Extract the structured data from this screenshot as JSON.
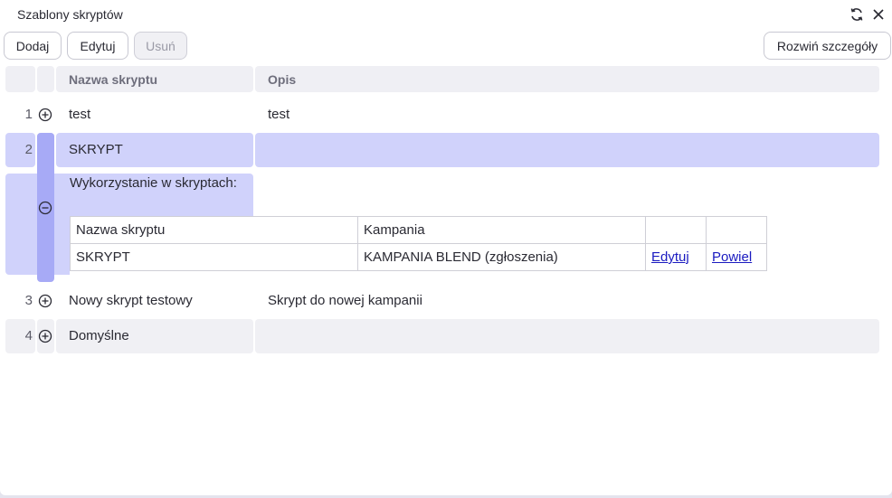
{
  "window": {
    "title": "Szablony skryptów"
  },
  "toolbar": {
    "add_label": "Dodaj",
    "edit_label": "Edytuj",
    "delete_label": "Usuń",
    "expand_label": "Rozwiń szczegóły"
  },
  "table": {
    "columns": [
      "Nazwa skryptu",
      "Opis"
    ],
    "rows": [
      {
        "num": "1",
        "name": "test",
        "desc": "test"
      },
      {
        "num": "2",
        "name": "SKRYPT",
        "desc": ""
      },
      {
        "num": "3",
        "name": "Nowy skrypt testowy",
        "desc": "Skrypt do nowej kampanii"
      },
      {
        "num": "4",
        "name": "Domyślne",
        "desc": ""
      }
    ]
  },
  "details": {
    "label": "Wykorzystanie w skryptach:",
    "columns": [
      "Nazwa skryptu",
      "Kampania",
      "",
      ""
    ],
    "rows": [
      {
        "name": "SKRYPT",
        "campaign": "KAMPANIA BLEND (zgłoszenia)",
        "edit": "Edytuj",
        "copy": "Powiel"
      }
    ]
  },
  "colors": {
    "selected_row": "#d0d2fb",
    "selected_column": "#a7aaf6",
    "link": "#1a1ac0"
  },
  "icons": {
    "refresh": "refresh-icon",
    "close": "close-icon",
    "expand": "plus-circle-icon",
    "collapse": "minus-circle-icon"
  }
}
